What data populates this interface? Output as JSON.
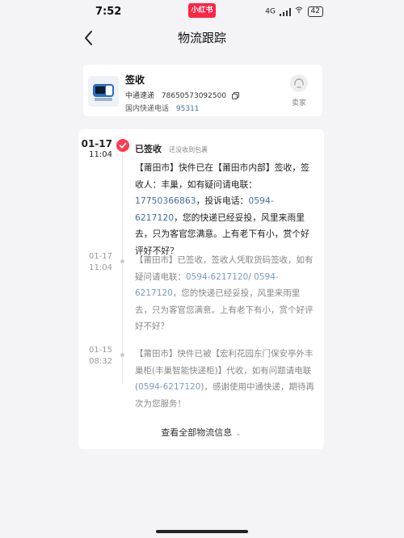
{
  "status_bar": {
    "time": "7:52",
    "brand": "小红书",
    "network": "4G",
    "battery": "42"
  },
  "nav": {
    "title": "物流跟踪"
  },
  "package": {
    "status": "签收",
    "carrier": "中通速递",
    "tracking_no": "78650573092500",
    "phone_label": "国内快递电话",
    "phone": "95311",
    "seller_label": "卖家"
  },
  "events": [
    {
      "date": "01-17",
      "time": "11:04",
      "status": "已签收",
      "sub": "还没收到包裹",
      "parts": [
        {
          "text": "【莆田市】快件已在【莆田市内部】签收，签收人：丰巢，如有疑问请电联："
        },
        {
          "text": "17750366863",
          "link": true
        },
        {
          "text": "，投诉电话："
        },
        {
          "text": "0594-6217120",
          "link": true
        },
        {
          "text": "，您的快递已经妥投，风里来雨里去，只为客官您满意。上有老下有小，赏个好评好不好？"
        }
      ]
    },
    {
      "date": "01-17",
      "time": "11:04",
      "parts": [
        {
          "text": "【莆田市】已签收，签收人凭取货码签收，如有疑问请电联："
        },
        {
          "text": "0594-6217120",
          "link": true
        },
        {
          "text": "/ "
        },
        {
          "text": "0594-6217120",
          "link": true
        },
        {
          "text": "，您的快递已经妥投，风里来雨里去，只为客官您满意。上有老下有小，赏个好评好不好？"
        }
      ]
    },
    {
      "date": "01-15",
      "time": "08:32",
      "parts": [
        {
          "text": "【莆田市】快件已被【宏利花园东门保安亭外丰巢柜(丰巢智能快递柜)】代收，如有问题请电联 ("
        },
        {
          "text": "0594-6217120",
          "link": true
        },
        {
          "text": ")，感谢使用中通快递，期待再次为您服务！"
        }
      ]
    }
  ],
  "view_all": "查看全部物流信息",
  "colors": {
    "accent": "#ff3b4d",
    "link": "#3f70a8",
    "brand": "#ff2442",
    "background": "#f4f4f6"
  }
}
